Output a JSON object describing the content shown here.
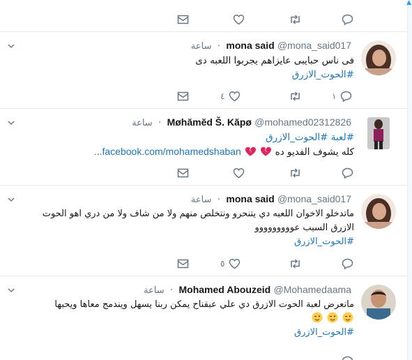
{
  "colors": {
    "accent": "#1da1f2",
    "link": "#1b75bb",
    "muted": "#657786",
    "border": "#e6ecf0",
    "heart_emoji": "#e0245e"
  },
  "icons": {
    "reply": "reply-icon",
    "retweet": "retweet-icon",
    "like": "heart-icon",
    "dm": "envelope-icon",
    "caret": "chevron-down-icon"
  },
  "tweets": [
    {
      "fullname": "mona said",
      "username": "@mona_said017",
      "dot": "·",
      "time": "ساعة",
      "line1": "فى ناس حبايبى عايزاهم يجربوا اللعبه دى",
      "hashtag": "#الحوت_الازرق",
      "reply_count": "١",
      "like_count": "٤"
    },
    {
      "fullname": "Møhămĕd Š. Kăpø",
      "username": "@mohamed02312826",
      "dot": "·",
      "time": "ساعة",
      "tag_prefix": "#لعبة",
      "hashtag": "#الحوت_الازرق",
      "line2": "كله يشوف الفديو ده",
      "link": "facebook.com/mohamedshaban...",
      "emoji": "broken-heart"
    },
    {
      "fullname": "mona said",
      "username": "@mona_said017",
      "dot": "·",
      "time": "ساعة",
      "line1": "ماتدخلو الاخوان اللعبه دي يتنحرو ونتخلص منهم ولا من شاف ولا من دري اهو الحوت",
      "line2": "الازرق السبب عووووووووو",
      "hashtag": "#الحوت_الازرق",
      "like_count": "٥"
    },
    {
      "fullname": "Mohamed Abouzeid",
      "username": "@Mohamedaama",
      "dot": "·",
      "time": "ساعة",
      "line1": "مانعرض لعبة الحوت الازرق دي علي عبقناح يمكن ربنا يسهل ويندمج معاها ويحبها",
      "emoji": "winking-face",
      "hashtag": "#الحوت_الازرق"
    }
  ]
}
